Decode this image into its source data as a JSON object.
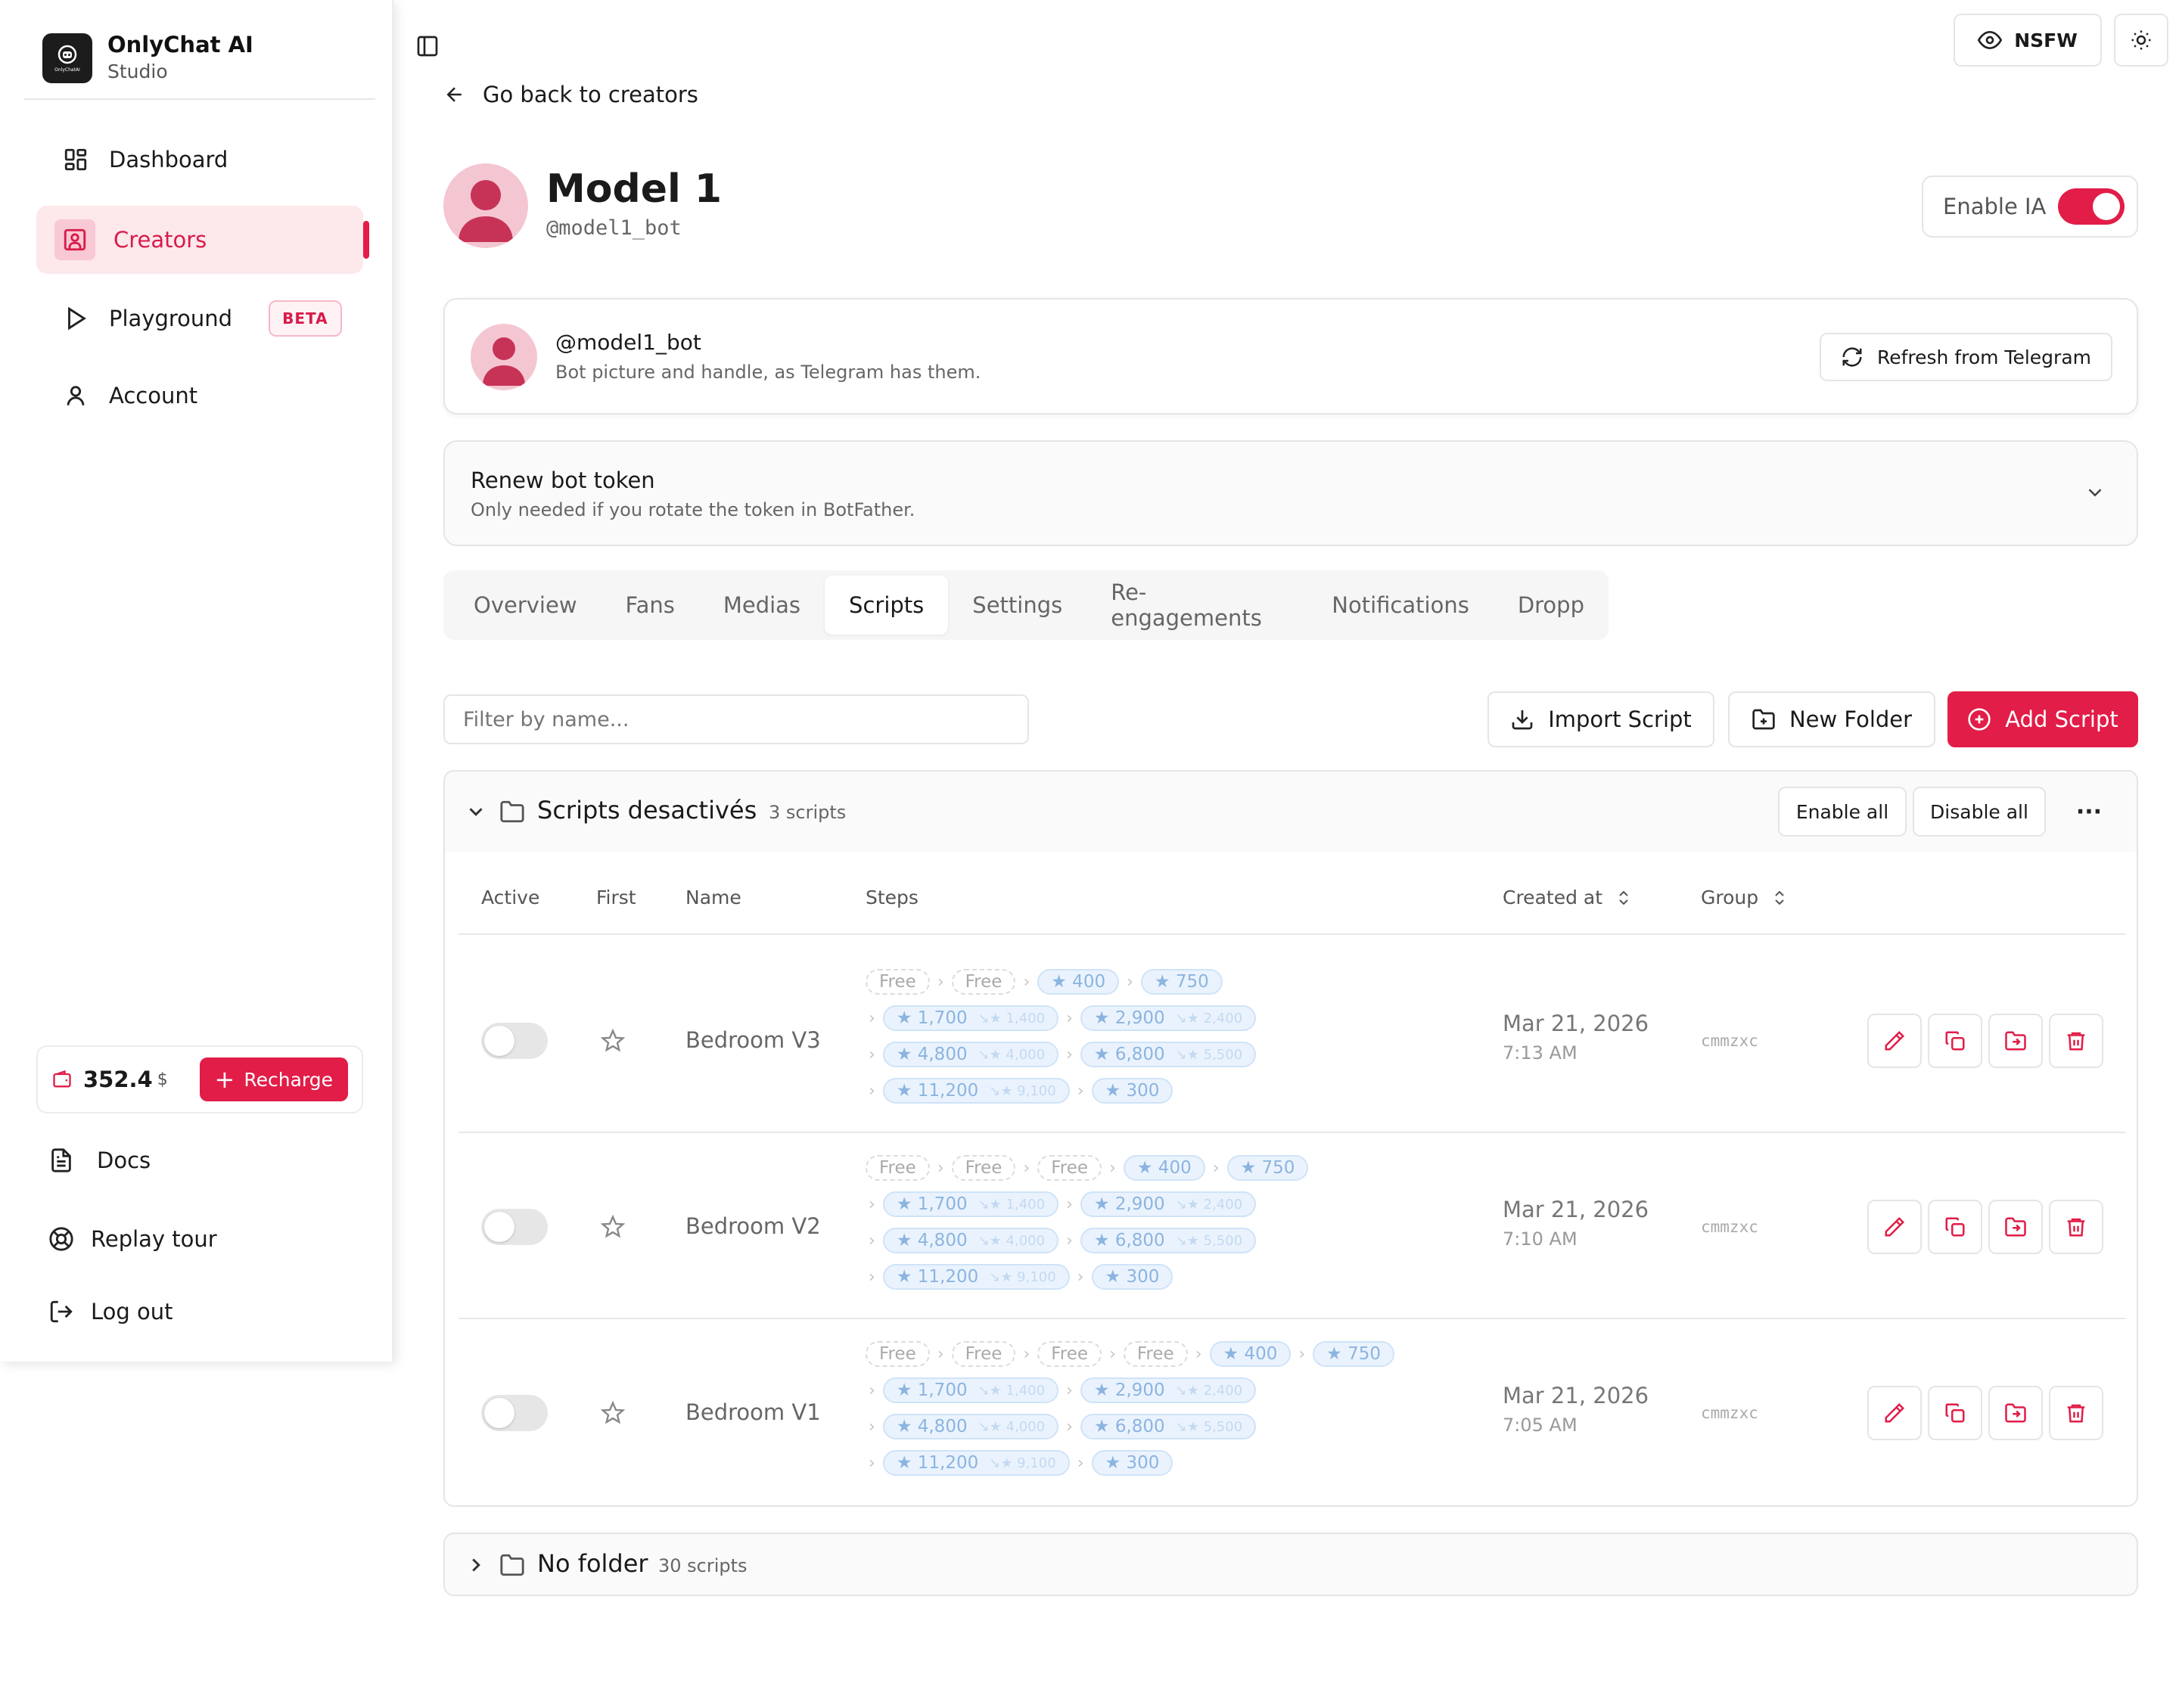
{
  "brand": {
    "title": "OnlyChat AI",
    "subtitle": "Studio",
    "logo_text": "OnlyChatAI"
  },
  "sidebar": {
    "items": [
      {
        "label": "Dashboard",
        "icon": "dashboard-icon"
      },
      {
        "label": "Creators",
        "icon": "creators-icon",
        "active": true
      },
      {
        "label": "Playground",
        "icon": "play-icon",
        "badge": "BETA"
      },
      {
        "label": "Account",
        "icon": "user-icon"
      }
    ],
    "wallet": {
      "amount": "352.4",
      "currency": "$",
      "recharge_label": "Recharge"
    },
    "bottom": [
      {
        "label": "Docs",
        "icon": "docs-icon"
      },
      {
        "label": "Replay tour",
        "icon": "lifebuoy-icon"
      },
      {
        "label": "Log out",
        "icon": "logout-icon"
      }
    ]
  },
  "topbar": {
    "nsfw_label": "NSFW",
    "theme_icon": "sun-icon"
  },
  "back_label": "Go back to creators",
  "model": {
    "name": "Model 1",
    "handle": "@model1_bot",
    "enable_ia_label": "Enable IA",
    "enable_ia": true
  },
  "bot_card": {
    "handle": "@model1_bot",
    "description": "Bot picture and handle, as Telegram has them.",
    "refresh_label": "Refresh from Telegram"
  },
  "renew_card": {
    "title": "Renew bot token",
    "description": "Only needed if you rotate the token in BotFather."
  },
  "tabs": [
    "Overview",
    "Fans",
    "Medias",
    "Scripts",
    "Settings",
    "Re-engagements",
    "Notifications",
    "Dropp"
  ],
  "active_tab": "Scripts",
  "toolbar": {
    "filter_placeholder": "Filter by name...",
    "import_label": "Import Script",
    "new_folder_label": "New Folder",
    "add_label": "Add Script"
  },
  "folder": {
    "name": "Scripts desactivés",
    "count": "3 scripts",
    "enable_all": "Enable all",
    "disable_all": "Disable all",
    "more": "···",
    "columns": {
      "active": "Active",
      "first": "First",
      "name": "Name",
      "steps": "Steps",
      "created": "Created at",
      "group": "Group"
    },
    "rows": [
      {
        "name": "Bedroom V3",
        "active": false,
        "date": "Mar 21, 2026",
        "time": "7:13 AM",
        "group": "cmmzxc",
        "lines": [
          [
            {
              "t": "Free"
            },
            {
              "t": "Free"
            },
            {
              "t": "★ 400"
            },
            {
              "t": "★ 750"
            }
          ],
          [
            {
              "t": "★ 1,700",
              "o": "↘★ 1,400"
            },
            {
              "t": "★ 2,900",
              "o": "↘★ 2,400"
            }
          ],
          [
            {
              "t": "★ 4,800",
              "o": "↘★ 4,000"
            },
            {
              "t": "★ 6,800",
              "o": "↘★ 5,500"
            }
          ],
          [
            {
              "t": "★ 11,200",
              "o": "↘★ 9,100"
            },
            {
              "t": "★ 300"
            }
          ]
        ]
      },
      {
        "name": "Bedroom V2",
        "active": false,
        "date": "Mar 21, 2026",
        "time": "7:10 AM",
        "group": "cmmzxc",
        "lines": [
          [
            {
              "t": "Free"
            },
            {
              "t": "Free"
            },
            {
              "t": "Free"
            },
            {
              "t": "★ 400"
            },
            {
              "t": "★ 750"
            }
          ],
          [
            {
              "t": "★ 1,700",
              "o": "↘★ 1,400"
            },
            {
              "t": "★ 2,900",
              "o": "↘★ 2,400"
            }
          ],
          [
            {
              "t": "★ 4,800",
              "o": "↘★ 4,000"
            },
            {
              "t": "★ 6,800",
              "o": "↘★ 5,500"
            }
          ],
          [
            {
              "t": "★ 11,200",
              "o": "↘★ 9,100"
            },
            {
              "t": "★ 300"
            }
          ]
        ]
      },
      {
        "name": "Bedroom V1",
        "active": false,
        "date": "Mar 21, 2026",
        "time": "7:05 AM",
        "group": "cmmzxc",
        "lines": [
          [
            {
              "t": "Free"
            },
            {
              "t": "Free"
            },
            {
              "t": "Free"
            },
            {
              "t": "Free"
            },
            {
              "t": "★ 400"
            },
            {
              "t": "★ 750"
            }
          ],
          [
            {
              "t": "★ 1,700",
              "o": "↘★ 1,400"
            },
            {
              "t": "★ 2,900",
              "o": "↘★ 2,400"
            }
          ],
          [
            {
              "t": "★ 4,800",
              "o": "↘★ 4,000"
            },
            {
              "t": "★ 6,800",
              "o": "↘★ 5,500"
            }
          ],
          [
            {
              "t": "★ 11,200",
              "o": "↘★ 9,100"
            },
            {
              "t": "★ 300"
            }
          ]
        ]
      }
    ]
  },
  "no_folder": {
    "name": "No folder",
    "count": "30 scripts"
  },
  "colors": {
    "accent": "#e11d48",
    "accent_soft": "#fde8ec",
    "pill_bg": "#eaf3fd",
    "pill_text": "#8cb4e0"
  }
}
